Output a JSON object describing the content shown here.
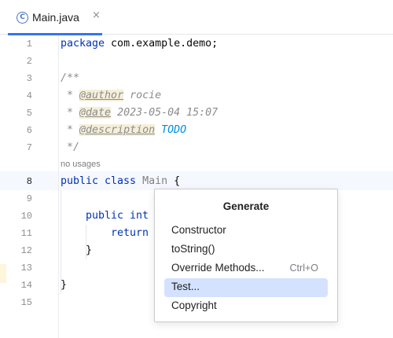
{
  "tab": {
    "icon": "class-c-icon",
    "title": "Main.java",
    "close_glyph": "×",
    "accent_color": "#3574f0"
  },
  "editor": {
    "line_numbers": [
      "1",
      "2",
      "3",
      "4",
      "5",
      "6",
      "7",
      "8",
      "9",
      "10",
      "11",
      "12",
      "13",
      "14",
      "15"
    ],
    "current_line": "8",
    "usage_hint": "no usages",
    "lines": {
      "l1_kw": "package",
      "l1_rest": " com.example.demo;",
      "l3": "/**",
      "l4_prefix": " * ",
      "l4_tag": "@author",
      "l4_rest": " rocie",
      "l5_prefix": " * ",
      "l5_tag": "@date",
      "l5_rest": " 2023-05-04 15:07",
      "l6_prefix": " * ",
      "l6_tag": "@description",
      "l6_todo": "TODO",
      "l7": " */",
      "l8_kw": "public class",
      "l8_cls": "Main",
      "l8_rest": " {",
      "l10": "public int",
      "l11": "return",
      "l12": "}",
      "l14": "}"
    }
  },
  "popup": {
    "title": "Generate",
    "items": [
      {
        "label": "Constructor",
        "shortcut": ""
      },
      {
        "label": "toString()",
        "shortcut": ""
      },
      {
        "label": "Override Methods...",
        "shortcut": "Ctrl+O"
      },
      {
        "label": "Test...",
        "shortcut": "",
        "selected": true
      },
      {
        "label": "Copyright",
        "shortcut": ""
      }
    ],
    "selected_color": "#d4e2ff"
  }
}
